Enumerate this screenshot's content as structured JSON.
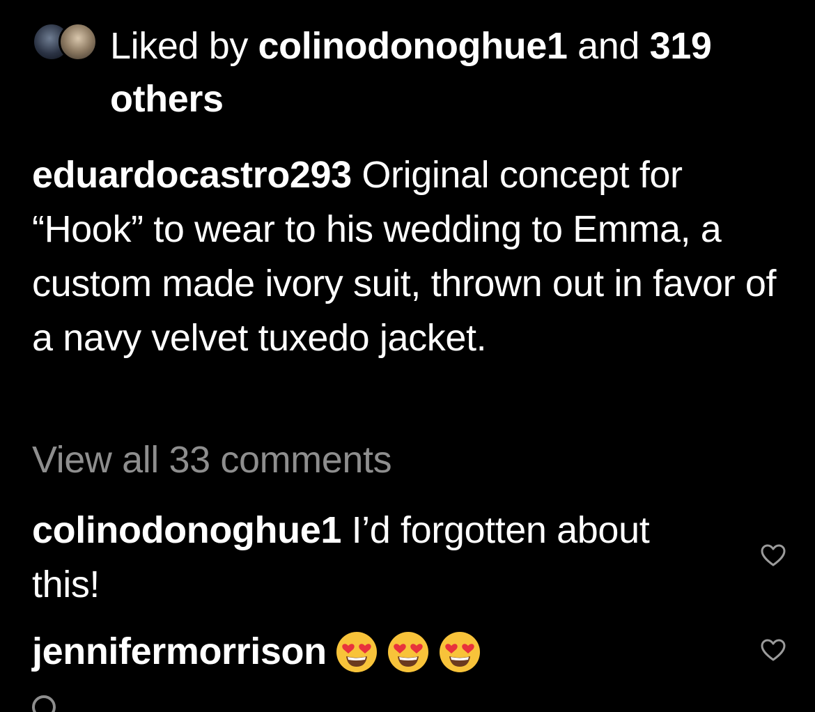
{
  "likes": {
    "prefix": "Liked by ",
    "user": "colinodonoghue1",
    "middle": " and ",
    "others": "319 others"
  },
  "post": {
    "username": "eduardocastro293",
    "caption": "Original concept for “Hook” to wear to his wedding to Emma, a custom made ivory suit, thrown out in favor of a navy velvet tuxedo jacket."
  },
  "view_all": "View all 33 comments",
  "comments": [
    {
      "username": "colinodonoghue1",
      "text": "I’d forgotten about this!"
    },
    {
      "username": "jennifermorrison",
      "emojis": [
        "smiling-face-with-heart-eyes",
        "smiling-face-with-heart-eyes",
        "smiling-face-with-heart-eyes"
      ]
    }
  ],
  "icons": {
    "like": "heart-outline-icon",
    "emoji": "smiling-face-with-heart-eyes-icon"
  },
  "colors": {
    "background": "#000000",
    "text": "#ffffff",
    "secondary": "#8e8e8e",
    "emoji_face": "#f8c33a",
    "emoji_heart": "#e8323c"
  }
}
